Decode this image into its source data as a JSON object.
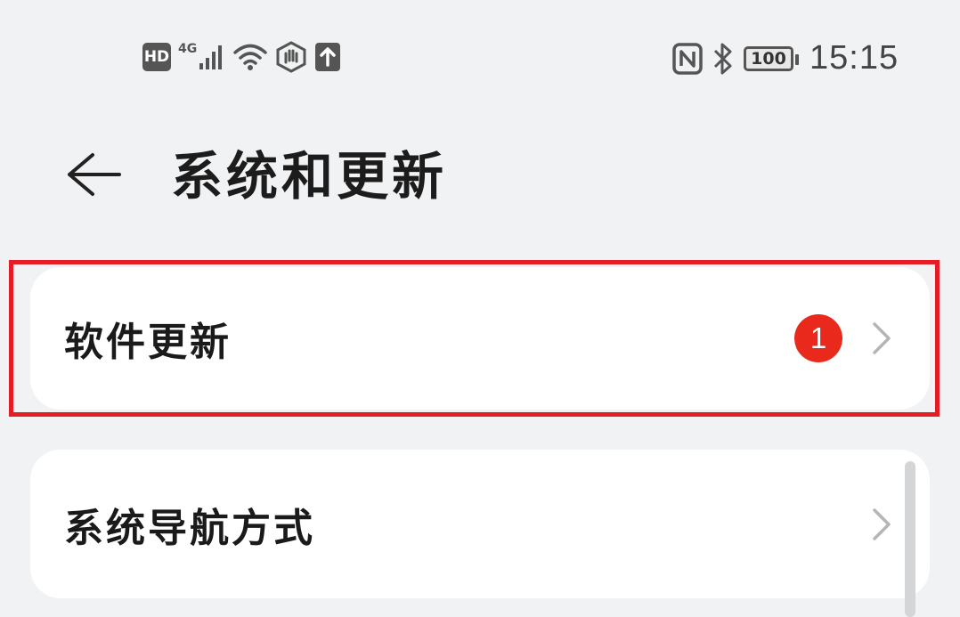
{
  "status_bar": {
    "hd": "HD",
    "network": "4G",
    "battery": "100",
    "time": "15:15"
  },
  "header": {
    "title": "系统和更新"
  },
  "items": [
    {
      "label": "软件更新",
      "badge": "1"
    },
    {
      "label": "系统导航方式"
    }
  ],
  "colors": {
    "background": "#f1f2f4",
    "card": "#ffffff",
    "badge": "#e8291c",
    "highlight": "#e31c25"
  }
}
